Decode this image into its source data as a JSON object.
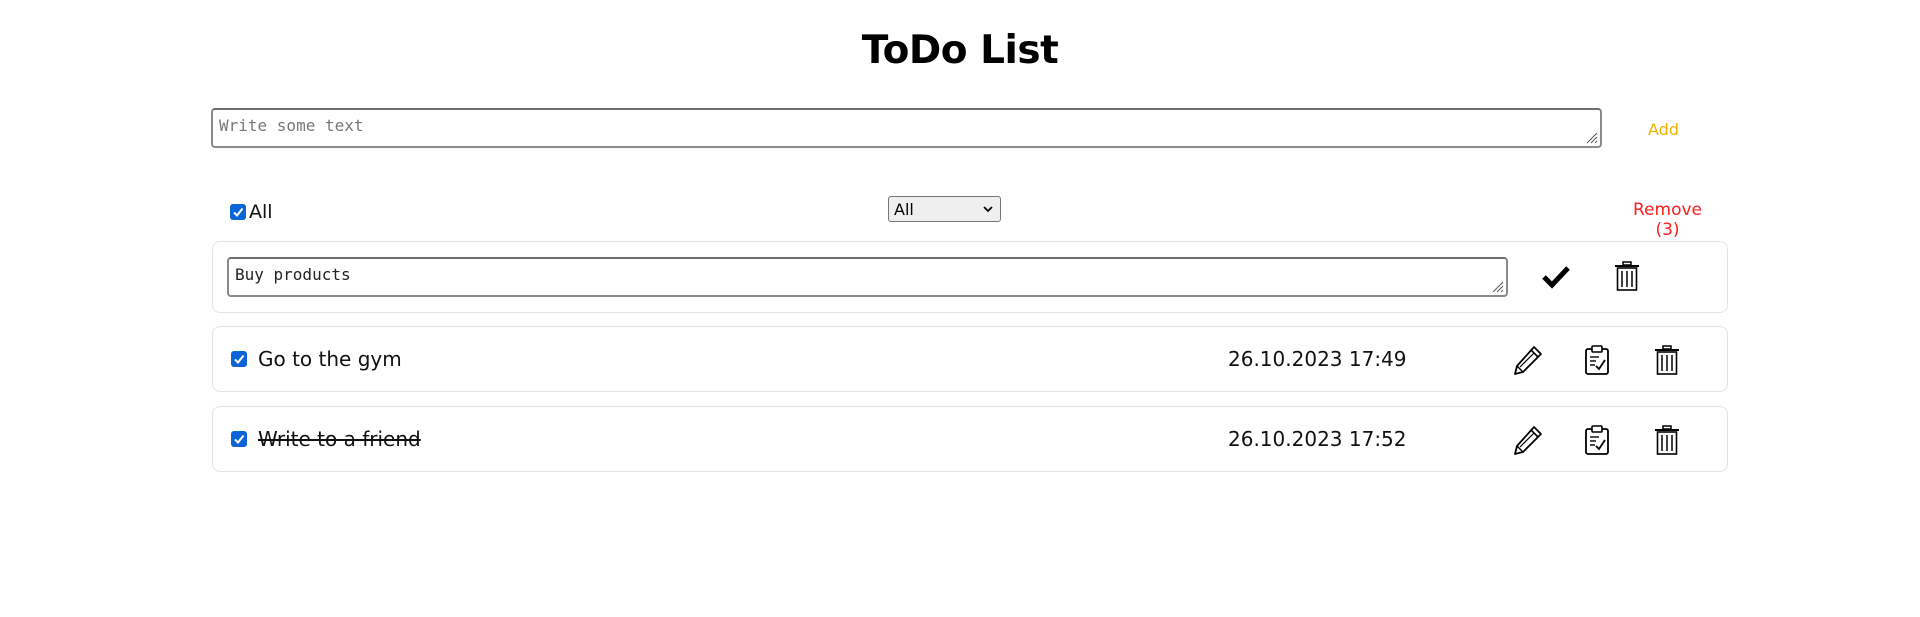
{
  "app": {
    "title": "ToDo List"
  },
  "new_task": {
    "placeholder": "Write some text",
    "value": "",
    "add_label": "Add"
  },
  "controls": {
    "select_all_label": "All",
    "select_all_checked": true,
    "filter": {
      "selected": "All"
    },
    "remove_label": "Remove (3)"
  },
  "colors": {
    "add": "#f0b400",
    "remove": "#ff1e1e",
    "checkbox": "#0b64d8"
  },
  "todos": [
    {
      "text": "Buy products",
      "editing": true,
      "actions": [
        "check-icon",
        "trash-icon"
      ]
    },
    {
      "text": "Go to the gym",
      "date": "26.10.2023 17:49",
      "checked": true,
      "completed": false,
      "actions": [
        "pencil-icon",
        "clipboard-check-icon",
        "trash-icon"
      ]
    },
    {
      "text": "Write to a friend",
      "date": "26.10.2023 17:52",
      "checked": true,
      "completed": true,
      "actions": [
        "pencil-icon",
        "clipboard-check-icon",
        "trash-icon"
      ]
    }
  ]
}
